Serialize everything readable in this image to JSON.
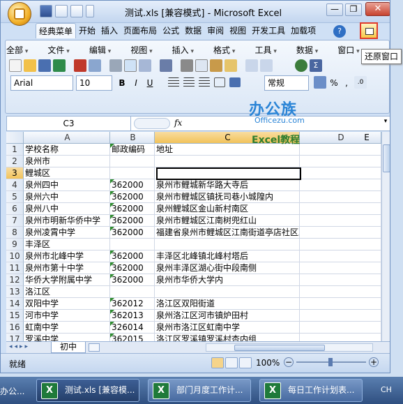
{
  "window": {
    "title": "测试.xls  [兼容模式] - Microsoft Excel",
    "tooltip": "还原窗口",
    "minimize_glyph": "—",
    "restore_glyph": "❐",
    "close_glyph": "✕"
  },
  "ribbon_tabs": [
    "经典菜单",
    "开始",
    "插入",
    "页面布局",
    "公式",
    "数据",
    "审阅",
    "视图",
    "开发工具",
    "加载项"
  ],
  "menu_items": [
    "全部",
    "文件",
    "编辑",
    "视图",
    "插入",
    "格式",
    "工具",
    "数据",
    "窗口"
  ],
  "font": {
    "name": "Arial",
    "size": "10"
  },
  "number_format": "常规",
  "format_buttons": {
    "bold": "B",
    "italic": "I",
    "underline": "U"
  },
  "symbols": {
    "percent": "%",
    "comma": ","
  },
  "name_box": "C3",
  "fx_label": "fx",
  "watermark": {
    "brand": "办公族",
    "site": "Officezu.com",
    "caption": "Excel教程"
  },
  "column_headers": [
    "A",
    "B",
    "C",
    "D",
    "E"
  ],
  "rows": [
    {
      "n": "1",
      "a": "学校名称",
      "b": "邮政编码",
      "c": "地址"
    },
    {
      "n": "2",
      "a": "泉州市",
      "b": "",
      "c": ""
    },
    {
      "n": "3",
      "a": "鲤城区",
      "b": "",
      "c": ""
    },
    {
      "n": "4",
      "a": "泉州四中",
      "b": "362000",
      "c": "泉州市鲤城新华路大寺后"
    },
    {
      "n": "5",
      "a": "泉州六中",
      "b": "362000",
      "c": "泉州市鲤城区镇抚司巷小城隍内"
    },
    {
      "n": "6",
      "a": "泉州八中",
      "b": "362000",
      "c": "泉州鲤城区金山新村南区"
    },
    {
      "n": "7",
      "a": "泉州市明新华侨中学",
      "b": "362000",
      "c": "泉州市鲤城区江南树兜红山"
    },
    {
      "n": "8",
      "a": "泉州凌霄中学",
      "b": "362000",
      "c": "福建省泉州市鲤城区江南街道亭店社区凌霄路321号"
    },
    {
      "n": "9",
      "a": "丰泽区",
      "b": "",
      "c": ""
    },
    {
      "n": "10",
      "a": "泉州市北峰中学",
      "b": "362000",
      "c": "丰泽区北峰镇北峰村塔后"
    },
    {
      "n": "11",
      "a": "泉州市第十中学",
      "b": "362000",
      "c": "泉州丰泽区湖心街中段南侧"
    },
    {
      "n": "12",
      "a": "华侨大学附属中学",
      "b": "362000",
      "c": "泉州市华侨大学内"
    },
    {
      "n": "13",
      "a": "洛江区",
      "b": "",
      "c": ""
    },
    {
      "n": "14",
      "a": "双阳中学",
      "b": "362012",
      "c": "洛江区双阳街道"
    },
    {
      "n": "15",
      "a": "河市中学",
      "b": "362013",
      "c": "泉州洛江区河市镇炉田村"
    },
    {
      "n": "16",
      "a": "虹南中学",
      "b": "326014",
      "c": "泉州市洛江区虹南中学"
    },
    {
      "n": "17",
      "a": "罗溪中学",
      "b": "362015",
      "c": "洛江区罗溪镇罗溪村杏内组"
    }
  ],
  "sheet_tab": "初中",
  "status": {
    "ready": "就绪",
    "zoom": "100%"
  },
  "taskbar": {
    "left_fragment": "办公...",
    "buttons": [
      "测试.xls  [兼容模...",
      "部门月度工作计...",
      "每日工作计划表..."
    ],
    "ime": "CH"
  }
}
